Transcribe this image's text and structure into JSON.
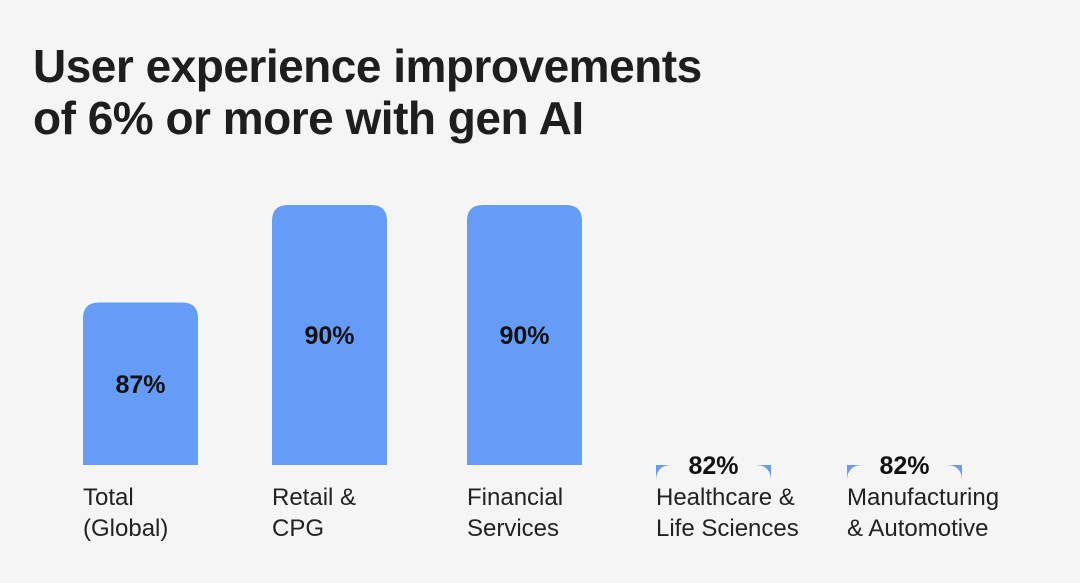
{
  "header": {
    "title_lines": [
      "User experience improvements",
      "of 6% or more with gen AI"
    ]
  },
  "chart_data": {
    "type": "bar",
    "title": "User experience improvements of 6% or more with gen AI",
    "categories": [
      [
        "Total",
        "(Global)"
      ],
      [
        "Retail &",
        "CPG"
      ],
      [
        "Financial",
        "Services"
      ],
      [
        "Healthcare &",
        "Life Sciences"
      ],
      [
        "Manufacturing",
        "& Automotive"
      ]
    ],
    "values": [
      87,
      90,
      90,
      82,
      82
    ],
    "value_labels": [
      "87%",
      "90%",
      "90%",
      "82%",
      "82%"
    ],
    "unit": "%",
    "bar_color": "#649cf7",
    "grid": false,
    "legend": "none"
  }
}
